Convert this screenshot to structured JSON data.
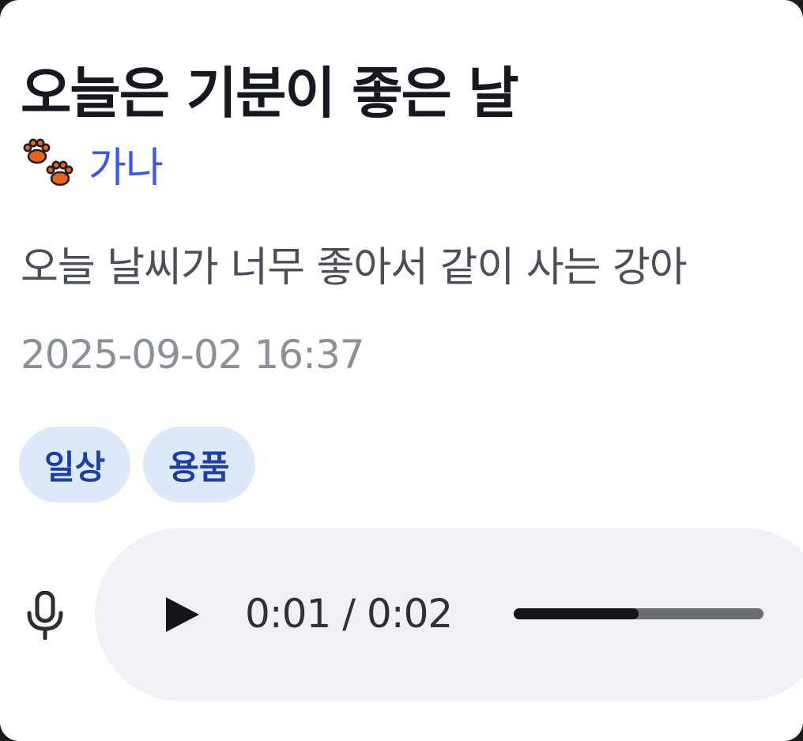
{
  "post": {
    "title": "오늘은 기분이 좋은 날",
    "author_icon": "paw-prints-icon",
    "author": "가나",
    "excerpt": "오늘 날씨가 너무 좋아서 같이 사는 강아",
    "timestamp": "2025-09-02 16:37",
    "tags": [
      "일상",
      "용품"
    ]
  },
  "audio": {
    "mic_icon": "microphone-icon",
    "play_icon": "play-icon",
    "current_time": "0:01",
    "separator": "/",
    "duration": "0:02",
    "time_label": "0:01 / 0:02",
    "progress": 0.5
  },
  "colors": {
    "author": "#3b57e8",
    "tag_bg": "#dde8fa",
    "tag_text": "#1e3fa6",
    "paw": "#e8641e",
    "player_bg": "#f0f1f4"
  }
}
